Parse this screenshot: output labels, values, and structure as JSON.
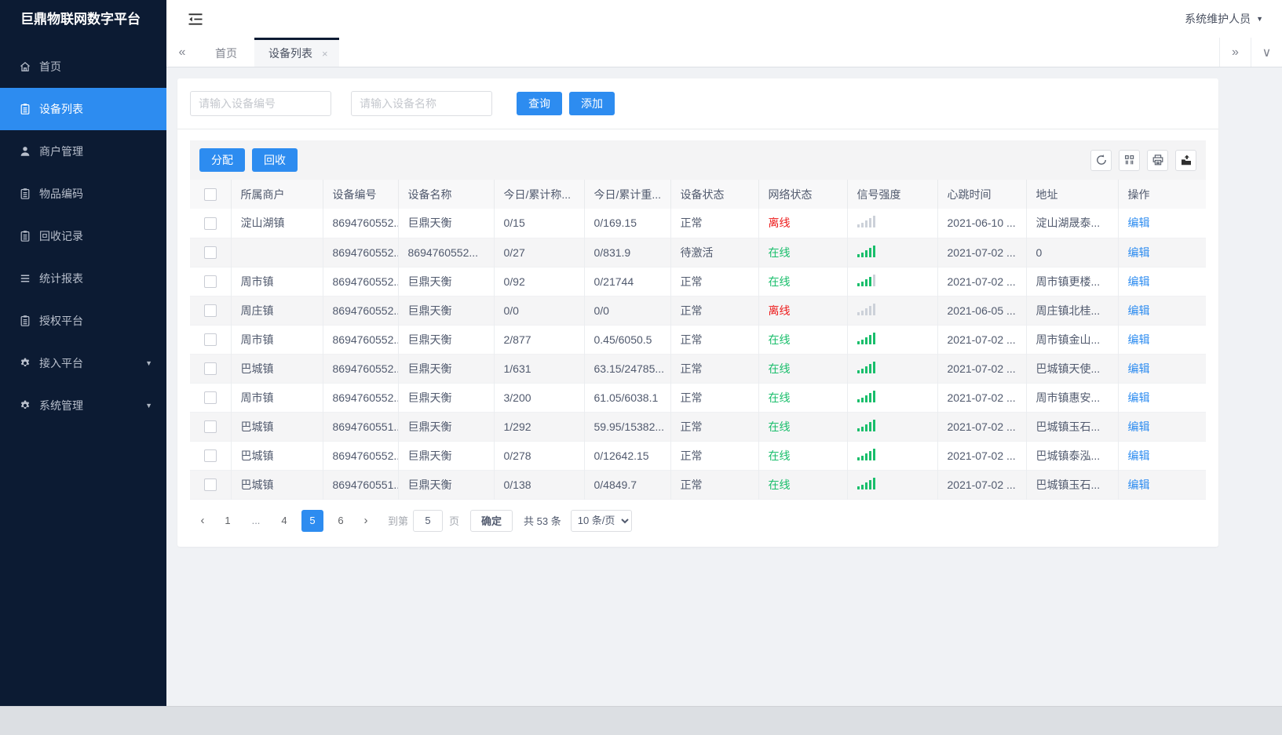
{
  "app": {
    "title": "巨鼎物联网数字平台",
    "user_menu": "系统维护人员"
  },
  "icons": {
    "tabs_left": "«",
    "tabs_right": "»",
    "tabs_dropdown": "∨",
    "close": "×",
    "caret_down": "▼",
    "prev": "‹",
    "next": "›",
    "ellipsis": "..."
  },
  "sidebar": {
    "items": [
      {
        "name": "home",
        "label": "首页",
        "icon": "home-icon",
        "active": false,
        "arrow": false
      },
      {
        "name": "device-list",
        "label": "设备列表",
        "icon": "clipboard-icon",
        "active": true,
        "arrow": false
      },
      {
        "name": "merchant-mgmt",
        "label": "商户管理",
        "icon": "user-icon",
        "active": false,
        "arrow": false
      },
      {
        "name": "item-code",
        "label": "物品编码",
        "icon": "clipboard-icon",
        "active": false,
        "arrow": false
      },
      {
        "name": "recycle-record",
        "label": "回收记录",
        "icon": "clipboard-icon",
        "active": false,
        "arrow": false
      },
      {
        "name": "stats-report",
        "label": "统计报表",
        "icon": "lines-icon",
        "active": false,
        "arrow": false
      },
      {
        "name": "auth-platform",
        "label": "授权平台",
        "icon": "clipboard-icon",
        "active": false,
        "arrow": false
      },
      {
        "name": "access-platform",
        "label": "接入平台",
        "icon": "gear-icon",
        "active": false,
        "arrow": true
      },
      {
        "name": "system-mgmt",
        "label": "系统管理",
        "icon": "gear-icon",
        "active": false,
        "arrow": true
      }
    ]
  },
  "tabs": {
    "items": [
      {
        "name": "home",
        "label": "首页",
        "active": false,
        "closable": false
      },
      {
        "name": "device-list",
        "label": "设备列表",
        "active": true,
        "closable": true
      }
    ]
  },
  "search": {
    "device_no_placeholder": "请输入设备编号",
    "device_name_placeholder": "请输入设备名称",
    "query_label": "查询",
    "add_label": "添加"
  },
  "toolbar": {
    "assign_label": "分配",
    "recycle_label": "回收",
    "icons": [
      "refresh-icon",
      "columns-icon",
      "print-icon",
      "export-icon"
    ]
  },
  "table": {
    "columns": [
      "所属商户",
      "设备编号",
      "设备名称",
      "今日/累计称...",
      "今日/累计重...",
      "设备状态",
      "网络状态",
      "信号强度",
      "心跳时间",
      "地址",
      "操作"
    ],
    "action_label": "编辑",
    "rows": [
      {
        "merchant": "淀山湖镇",
        "device_no": "8694760552...",
        "device_name": "巨鼎天衡",
        "today_count": "0/15",
        "today_weight": "0/169.15",
        "device_status": "正常",
        "network_status": "离线",
        "online": false,
        "signal": 0,
        "heartbeat": "2021-06-10 ...",
        "address": "淀山湖晟泰..."
      },
      {
        "merchant": "",
        "device_no": "8694760552...",
        "device_name": "8694760552...",
        "today_count": "0/27",
        "today_weight": "0/831.9",
        "device_status": "待激活",
        "network_status": "在线",
        "online": true,
        "signal": 5,
        "heartbeat": "2021-07-02 ...",
        "address": "0"
      },
      {
        "merchant": "周市镇",
        "device_no": "8694760552...",
        "device_name": "巨鼎天衡",
        "today_count": "0/92",
        "today_weight": "0/21744",
        "device_status": "正常",
        "network_status": "在线",
        "online": true,
        "signal": 4,
        "heartbeat": "2021-07-02 ...",
        "address": "周市镇更楼..."
      },
      {
        "merchant": "周庄镇",
        "device_no": "8694760552...",
        "device_name": "巨鼎天衡",
        "today_count": "0/0",
        "today_weight": "0/0",
        "device_status": "正常",
        "network_status": "离线",
        "online": false,
        "signal": 0,
        "heartbeat": "2021-06-05 ...",
        "address": "周庄镇北桂..."
      },
      {
        "merchant": "周市镇",
        "device_no": "8694760552...",
        "device_name": "巨鼎天衡",
        "today_count": "2/877",
        "today_weight": "0.45/6050.5",
        "device_status": "正常",
        "network_status": "在线",
        "online": true,
        "signal": 5,
        "heartbeat": "2021-07-02 ...",
        "address": "周市镇金山..."
      },
      {
        "merchant": "巴城镇",
        "device_no": "8694760552...",
        "device_name": "巨鼎天衡",
        "today_count": "1/631",
        "today_weight": "63.15/24785...",
        "device_status": "正常",
        "network_status": "在线",
        "online": true,
        "signal": 5,
        "heartbeat": "2021-07-02 ...",
        "address": "巴城镇天使..."
      },
      {
        "merchant": "周市镇",
        "device_no": "8694760552...",
        "device_name": "巨鼎天衡",
        "today_count": "3/200",
        "today_weight": "61.05/6038.1",
        "device_status": "正常",
        "network_status": "在线",
        "online": true,
        "signal": 5,
        "heartbeat": "2021-07-02 ...",
        "address": "周市镇惠安..."
      },
      {
        "merchant": "巴城镇",
        "device_no": "8694760551...",
        "device_name": "巨鼎天衡",
        "today_count": "1/292",
        "today_weight": "59.95/15382...",
        "device_status": "正常",
        "network_status": "在线",
        "online": true,
        "signal": 5,
        "heartbeat": "2021-07-02 ...",
        "address": "巴城镇玉石..."
      },
      {
        "merchant": "巴城镇",
        "device_no": "8694760552...",
        "device_name": "巨鼎天衡",
        "today_count": "0/278",
        "today_weight": "0/12642.15",
        "device_status": "正常",
        "network_status": "在线",
        "online": true,
        "signal": 5,
        "heartbeat": "2021-07-02 ...",
        "address": "巴城镇泰泓..."
      },
      {
        "merchant": "巴城镇",
        "device_no": "8694760551...",
        "device_name": "巨鼎天衡",
        "today_count": "0/138",
        "today_weight": "0/4849.7",
        "device_status": "正常",
        "network_status": "在线",
        "online": true,
        "signal": 5,
        "heartbeat": "2021-07-02 ...",
        "address": "巴城镇玉石..."
      }
    ]
  },
  "pagination": {
    "pages": [
      "1",
      "...",
      "4",
      "5",
      "6"
    ],
    "active_page": "5",
    "goto_label": "到第",
    "goto_value": "5",
    "page_unit": "页",
    "confirm_label": "确定",
    "total_label": "共 53 条",
    "page_size": "10 条/页"
  },
  "colors": {
    "primary": "#2d8cf0",
    "sidebar_bg": "#0c1b33",
    "online": "#19be6b",
    "offline": "#ed1c1c"
  }
}
